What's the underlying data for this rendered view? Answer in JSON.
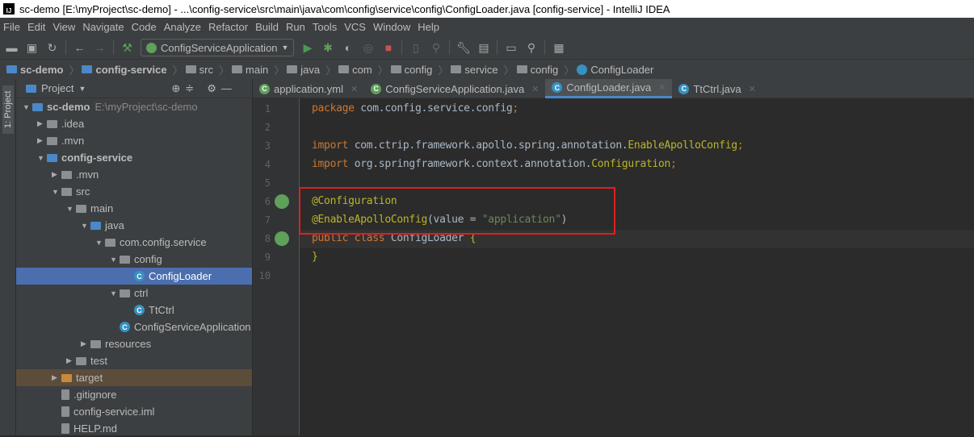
{
  "window": {
    "title": "sc-demo [E:\\myProject\\sc-demo] - ...\\config-service\\src\\main\\java\\com\\config\\service\\config\\ConfigLoader.java [config-service] - IntelliJ IDEA",
    "logo": "IJ"
  },
  "menu": [
    "File",
    "Edit",
    "View",
    "Navigate",
    "Code",
    "Analyze",
    "Refactor",
    "Build",
    "Run",
    "Tools",
    "VCS",
    "Window",
    "Help"
  ],
  "toolbar": {
    "run_config": "ConfigServiceApplication"
  },
  "breadcrumbs": [
    "sc-demo",
    "config-service",
    "src",
    "main",
    "java",
    "com",
    "config",
    "service",
    "config",
    "ConfigLoader"
  ],
  "sidebar_stripe": "1: Project",
  "project_panel": {
    "title": "Project",
    "tree": [
      {
        "label": "sc-demo",
        "path": "E:\\myProject\\sc-demo",
        "level": 0,
        "arrow": "down",
        "icon": "module",
        "bold": true
      },
      {
        "label": ".idea",
        "level": 1,
        "arrow": "right",
        "icon": "folder"
      },
      {
        "label": ".mvn",
        "level": 1,
        "arrow": "right",
        "icon": "folder"
      },
      {
        "label": "config-service",
        "level": 1,
        "arrow": "down",
        "icon": "module",
        "bold": true
      },
      {
        "label": ".mvn",
        "level": 2,
        "arrow": "right",
        "icon": "folder"
      },
      {
        "label": "src",
        "level": 2,
        "arrow": "down",
        "icon": "folder"
      },
      {
        "label": "main",
        "level": 3,
        "arrow": "down",
        "icon": "folder"
      },
      {
        "label": "java",
        "level": 4,
        "arrow": "down",
        "icon": "source-folder"
      },
      {
        "label": "com.config.service",
        "level": 5,
        "arrow": "down",
        "icon": "package"
      },
      {
        "label": "config",
        "level": 6,
        "arrow": "down",
        "icon": "package"
      },
      {
        "label": "ConfigLoader",
        "level": 7,
        "icon": "class",
        "selected": true
      },
      {
        "label": "ctrl",
        "level": 6,
        "arrow": "down",
        "icon": "package"
      },
      {
        "label": "TtCtrl",
        "level": 7,
        "icon": "class"
      },
      {
        "label": "ConfigServiceApplication",
        "level": 6,
        "icon": "spring-class"
      },
      {
        "label": "resources",
        "level": 4,
        "arrow": "right",
        "icon": "folder"
      },
      {
        "label": "test",
        "level": 3,
        "arrow": "right",
        "icon": "folder"
      },
      {
        "label": "target",
        "level": 2,
        "arrow": "right",
        "icon": "excluded-folder",
        "excluded": true
      },
      {
        "label": ".gitignore",
        "level": 2,
        "icon": "file"
      },
      {
        "label": "config-service.iml",
        "level": 2,
        "icon": "file"
      },
      {
        "label": "HELP.md",
        "level": 2,
        "icon": "file"
      }
    ]
  },
  "tabs": [
    {
      "label": "application.yml",
      "icon": "yml"
    },
    {
      "label": "ConfigServiceApplication.java",
      "icon": "spring-class"
    },
    {
      "label": "ConfigLoader.java",
      "icon": "class",
      "active": true
    },
    {
      "label": "TtCtrl.java",
      "icon": "class"
    }
  ],
  "code": [
    [
      {
        "t": "package ",
        "c": "kw"
      },
      {
        "t": "com.config.service.config",
        "c": ""
      },
      {
        "t": ";",
        "c": "kw"
      }
    ],
    [],
    [
      {
        "t": "import ",
        "c": "kw"
      },
      {
        "t": "com.ctrip.framework.apollo.spring.annotation.",
        "c": ""
      },
      {
        "t": "EnableApolloConfig",
        "c": "ann"
      },
      {
        "t": ";",
        "c": "kw"
      }
    ],
    [
      {
        "t": "import ",
        "c": "kw"
      },
      {
        "t": "org.springframework.context.annotation.",
        "c": ""
      },
      {
        "t": "Configuration",
        "c": "ann"
      },
      {
        "t": ";",
        "c": "kw"
      }
    ],
    [],
    [
      {
        "t": "@Configuration",
        "c": "ann"
      }
    ],
    [
      {
        "t": "@EnableApolloConfig",
        "c": "ann"
      },
      {
        "t": "(value = ",
        "c": ""
      },
      {
        "t": "\"application\"",
        "c": "str"
      },
      {
        "t": ")",
        "c": ""
      }
    ],
    [
      {
        "t": "public class ",
        "c": "kw"
      },
      {
        "t": "ConfigLoader ",
        "c": ""
      },
      {
        "t": "{",
        "c": "ann"
      }
    ],
    [
      {
        "t": "}",
        "c": "ann"
      }
    ],
    []
  ],
  "highlight_color": "#e0201c"
}
